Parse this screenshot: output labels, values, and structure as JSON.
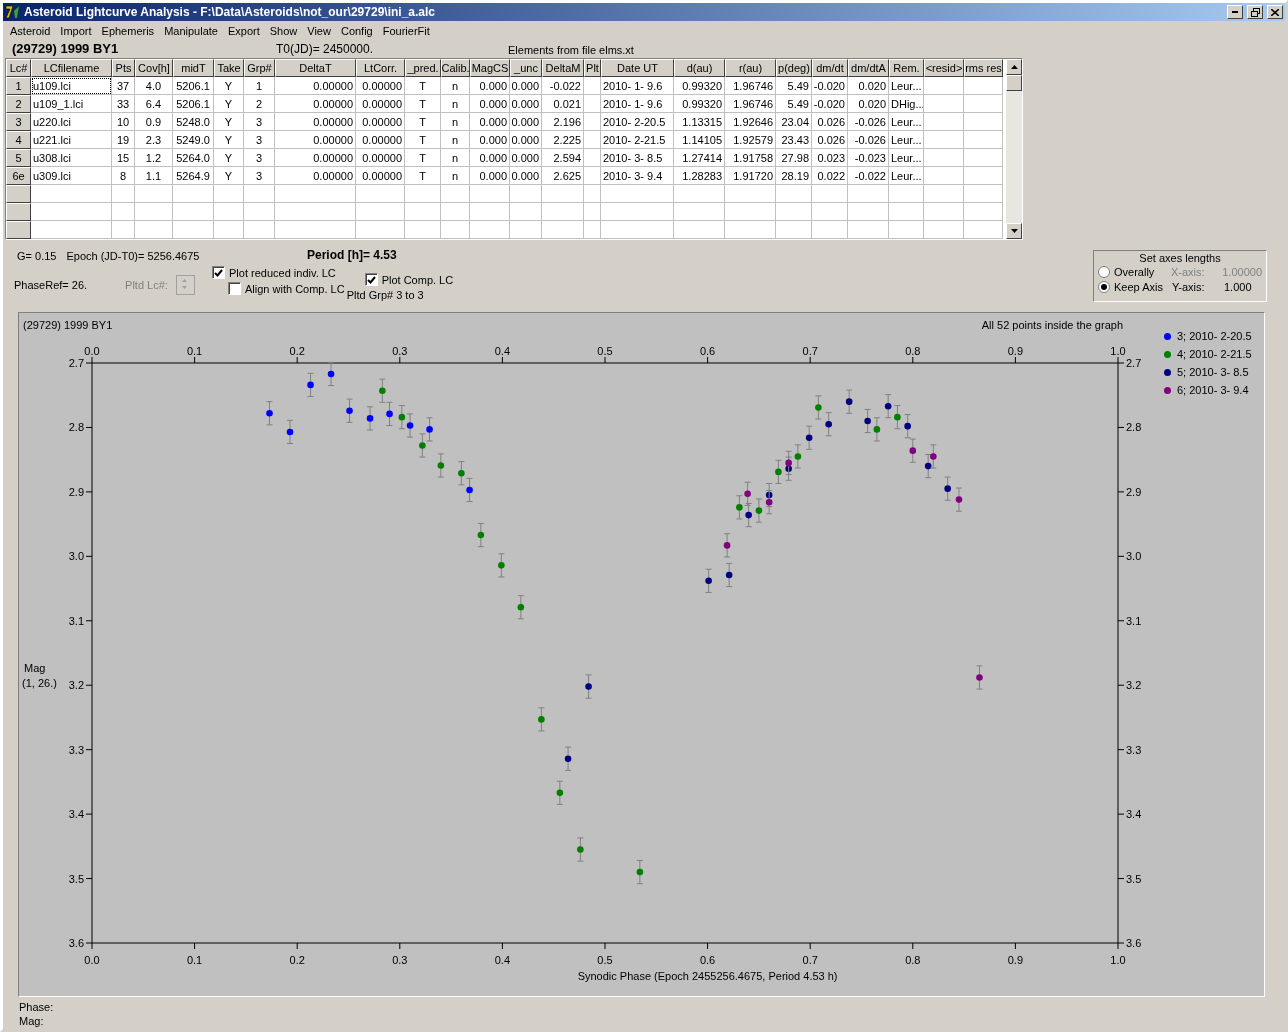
{
  "window": {
    "title": "Asteroid Lightcurve Analysis - F:\\Data\\Asteroids\\not_our\\29729\\ini_a.alc"
  },
  "menu": [
    "Asteroid",
    "Import",
    "Ephemeris",
    "Manipulate",
    "Export",
    "Show",
    "View",
    "Config",
    "FourierFit"
  ],
  "info": {
    "object": "(29729) 1999 BY1",
    "t0": "T0(JD)= 2450000.",
    "elements": "Elements from file elms.xt"
  },
  "table": {
    "columns": [
      "Lc#",
      "LCfilename",
      "Pts",
      "Cov[h]",
      "midT",
      "Take",
      "Grp#",
      "DeltaT",
      "LtCorr.",
      "_pred.",
      "Calib.",
      "MagCS",
      "_unc",
      "DeltaM",
      "Plt",
      "Date UT",
      "d(au)",
      "r(au)",
      "p(deg)",
      "dm/dt",
      "dm/dtA",
      "Rem.",
      "<resid>",
      "rms res"
    ],
    "rows": [
      {
        "cells": [
          "1",
          "u109.lci",
          "37",
          "4.0",
          "5206.1",
          "Y",
          "1",
          "0.00000",
          "0.00000",
          "T",
          "n",
          "0.000",
          "0.000",
          "-0.022",
          null,
          "2010- 1- 9.6",
          "0.99320",
          "1.96746",
          "5.49",
          "-0.020",
          "0.020",
          "Leur..."
        ],
        "focused": true
      },
      {
        "cells": [
          "2",
          "u109_1.lci",
          "33",
          "6.4",
          "5206.1",
          "Y",
          "2",
          "0.00000",
          "0.00000",
          "T",
          "n",
          "0.000",
          "0.000",
          "0.021",
          null,
          "2010- 1- 9.6",
          "0.99320",
          "1.96746",
          "5.49",
          "-0.020",
          "0.020",
          "DHig..."
        ],
        "focused": false
      },
      {
        "cells": [
          "3",
          "u220.lci",
          "10",
          "0.9",
          "5248.0",
          "Y",
          "3",
          "0.00000",
          "0.00000",
          "T",
          "n",
          "0.000",
          "0.000",
          "2.196",
          null,
          "2010- 2-20.5",
          "1.13315",
          "1.92646",
          "23.04",
          "0.026",
          "-0.026",
          "Leur..."
        ],
        "focused": false
      },
      {
        "cells": [
          "4",
          "u221.lci",
          "19",
          "2.3",
          "5249.0",
          "Y",
          "3",
          "0.00000",
          "0.00000",
          "T",
          "n",
          "0.000",
          "0.000",
          "2.225",
          null,
          "2010- 2-21.5",
          "1.14105",
          "1.92579",
          "23.43",
          "0.026",
          "-0.026",
          "Leur..."
        ],
        "focused": false
      },
      {
        "cells": [
          "5",
          "u308.lci",
          "15",
          "1.2",
          "5264.0",
          "Y",
          "3",
          "0.00000",
          "0.00000",
          "T",
          "n",
          "0.000",
          "0.000",
          "2.594",
          null,
          "2010- 3- 8.5",
          "1.27414",
          "1.91758",
          "27.98",
          "0.023",
          "-0.023",
          "Leur..."
        ],
        "focused": false
      },
      {
        "cells": [
          "6e",
          "u309.lci",
          "8",
          "1.1",
          "5264.9",
          "Y",
          "3",
          "0.00000",
          "0.00000",
          "T",
          "n",
          "0.000",
          "0.000",
          "2.625",
          null,
          "2010- 3- 9.4",
          "1.28283",
          "1.91720",
          "28.19",
          "0.022",
          "-0.022",
          "Leur..."
        ],
        "focused": false
      }
    ]
  },
  "params": {
    "g": "G= 0.15",
    "epoch": "Epoch (JD-T0)= 5256.4675",
    "period": "Period [h]= 4.53",
    "phase_ref": "PhaseRef= 26.",
    "pltd_lc": {
      "label": "Pltd Lc#:",
      "disabled": true
    },
    "pltd_grp": "Pltd Grp#  3  to  3"
  },
  "checkboxes": [
    {
      "label": "Plot reduced indiv. LC",
      "checked": true
    },
    {
      "label": "Align with Comp. LC",
      "checked": false
    },
    {
      "label": "Plot Comp. LC",
      "checked": true
    }
  ],
  "axes_box": {
    "title": "Set axes lengths",
    "options": [
      {
        "label": "Overally",
        "selected": false
      },
      {
        "label": "Keep Axis",
        "selected": true
      }
    ],
    "fields": [
      {
        "label": "X-axis:",
        "value": "1.00000",
        "disabled": true
      },
      {
        "label": "Y-axis:",
        "value": "1.000",
        "disabled": false
      }
    ]
  },
  "plot": {
    "points_note": "All 52 points inside the graph",
    "ylabel_sub": "(1, 26.)",
    "chart_data": {
      "type": "scatter",
      "title": "(29729) 1999 BY1",
      "xlabel": "Synodic Phase (Epoch 2455256.4675, Period 4.53 h)",
      "ylabel": "Mag",
      "xlim": [
        0,
        1
      ],
      "ylim": [
        3.6,
        2.7
      ],
      "xticks": [
        {
          "value": 0,
          "label": "0.0"
        },
        {
          "value": 0.1,
          "label": "0.1"
        },
        {
          "value": 0.2,
          "label": "0.2"
        },
        {
          "value": 0.3,
          "label": "0.3"
        },
        {
          "value": 0.4,
          "label": "0.4"
        },
        {
          "value": 0.5,
          "label": "0.5"
        },
        {
          "value": 0.6,
          "label": "0.6"
        },
        {
          "value": 0.7,
          "label": "0.7"
        },
        {
          "value": 0.8,
          "label": "0.8"
        },
        {
          "value": 0.9,
          "label": "0.9"
        },
        {
          "value": 1,
          "label": "1.0"
        }
      ],
      "yticks": [
        {
          "value": 2.7,
          "label": "2.7"
        },
        {
          "value": 2.8,
          "label": "2.8"
        },
        {
          "value": 2.9,
          "label": "2.9"
        },
        {
          "value": 3.0,
          "label": "3.0"
        },
        {
          "value": 3.1,
          "label": "3.1"
        },
        {
          "value": 3.2,
          "label": "3.2"
        },
        {
          "value": 3.3,
          "label": "3.3"
        },
        {
          "value": 3.4,
          "label": "3.4"
        },
        {
          "value": 3.5,
          "label": "3.5"
        },
        {
          "value": 3.6,
          "label": "3.6"
        }
      ],
      "series": [
        {
          "name": "3; 2010- 2-20.5",
          "color": "#0000ff",
          "x": [
            0.173,
            0.193,
            0.213,
            0.233,
            0.251,
            0.271,
            0.29,
            0.31,
            0.329,
            0.368
          ],
          "values": [
            2.778,
            2.807,
            2.734,
            2.717,
            2.774,
            2.786,
            2.779,
            2.797,
            2.803,
            2.897
          ]
        },
        {
          "name": "4; 2010- 2-21.5",
          "color": "#008000",
          "x": [
            0.283,
            0.302,
            0.322,
            0.34,
            0.36,
            0.379,
            0.399,
            0.418,
            0.438,
            0.456,
            0.476,
            0.534,
            0.631,
            0.65,
            0.669,
            0.688,
            0.708,
            0.765,
            0.785
          ],
          "values": [
            2.743,
            2.784,
            2.828,
            2.859,
            2.871,
            2.967,
            3.014,
            3.079,
            3.253,
            3.367,
            3.455,
            3.49,
            2.924,
            2.929,
            2.869,
            2.845,
            2.769,
            2.803,
            2.784
          ]
        },
        {
          "name": "5; 2010- 3- 8.5",
          "color": "#000080",
          "x": [
            0.464,
            0.484,
            0.601,
            0.621,
            0.64,
            0.66,
            0.679,
            0.699,
            0.718,
            0.738,
            0.756,
            0.776,
            0.795,
            0.815,
            0.834
          ],
          "values": [
            3.314,
            3.202,
            3.038,
            3.029,
            2.936,
            2.905,
            2.864,
            2.816,
            2.795,
            2.76,
            2.79,
            2.767,
            2.798,
            2.86,
            2.895
          ]
        },
        {
          "name": "6; 2010- 3- 9.4",
          "color": "#800080",
          "x": [
            0.619,
            0.639,
            0.66,
            0.679,
            0.8,
            0.82,
            0.845,
            0.865
          ],
          "values": [
            2.983,
            2.903,
            2.916,
            2.855,
            2.836,
            2.845,
            2.912,
            3.188
          ]
        }
      ]
    }
  },
  "status": [
    "Phase:",
    "Mag:"
  ]
}
